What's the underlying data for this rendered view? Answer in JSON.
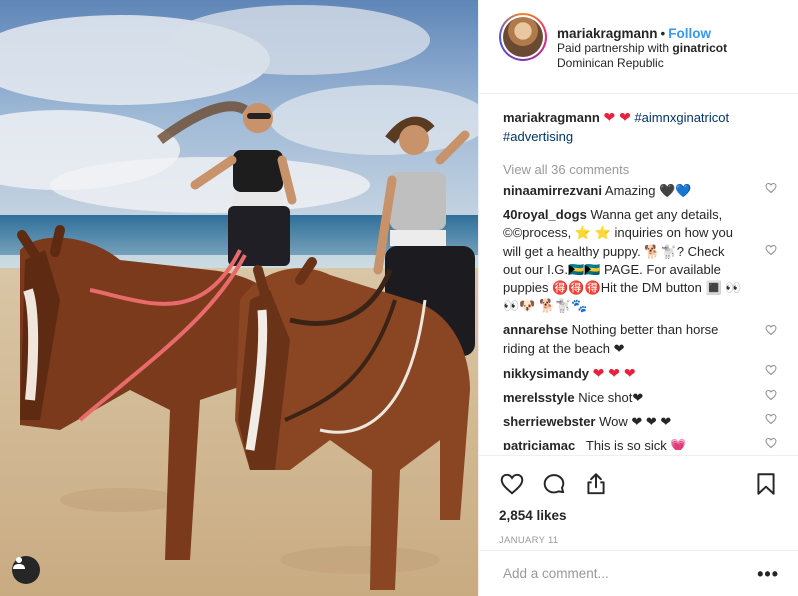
{
  "post": {
    "username": "mariakragmann",
    "follow_label": "Follow",
    "separator": "•",
    "partnership_prefix": "Paid partnership with",
    "partner": "ginatricot",
    "location": "Dominican Republic",
    "avatar_icon": "profile-avatar"
  },
  "caption": {
    "username": "mariakragmann",
    "emoji": "❤ ❤",
    "hashtag_1": "#aimnxginatricot",
    "hashtag_2": "#advertising"
  },
  "view_all_comments": "View all 36 comments",
  "comments": [
    {
      "user": "ninaamirrezvani",
      "text": "Amazing 🖤💙"
    },
    {
      "user": "40royal_dogs",
      "text": "Wanna get any details, ©©process, ⭐ ⭐ inquiries on how you will get a healthy puppy. 🐕🐩? Check out our I.G.🇧🇸🇧🇸 PAGE. For available puppies 🉐🉐🉐Hit the DM button 🔳 👀👀🐶 🐕🐩🐾"
    },
    {
      "user": "annarehse",
      "text": "Nothing better than horse riding at the beach ❤"
    },
    {
      "user": "nikkysimandy",
      "text": "❤ ❤ ❤"
    },
    {
      "user": "merelsstyle",
      "text": "Nice shot❤"
    },
    {
      "user": "sherriewebster",
      "text": "Wow ❤ ❤ ❤"
    },
    {
      "user": "patriciamac_",
      "text": "This is so sick 💗"
    }
  ],
  "actions": {
    "like_icon": "heart-outline",
    "comment_icon": "speech-bubble",
    "share_icon": "share-arrow",
    "save_icon": "bookmark"
  },
  "likes": "2,854 likes",
  "date": "JANUARY 11",
  "add_comment_placeholder": "Add a comment...",
  "more_options": "•••",
  "colors": {
    "link_blue": "#3897f0",
    "hashtag": "#003569",
    "heart_red": "#e8213c",
    "muted": "#999999",
    "border": "#efefef"
  }
}
